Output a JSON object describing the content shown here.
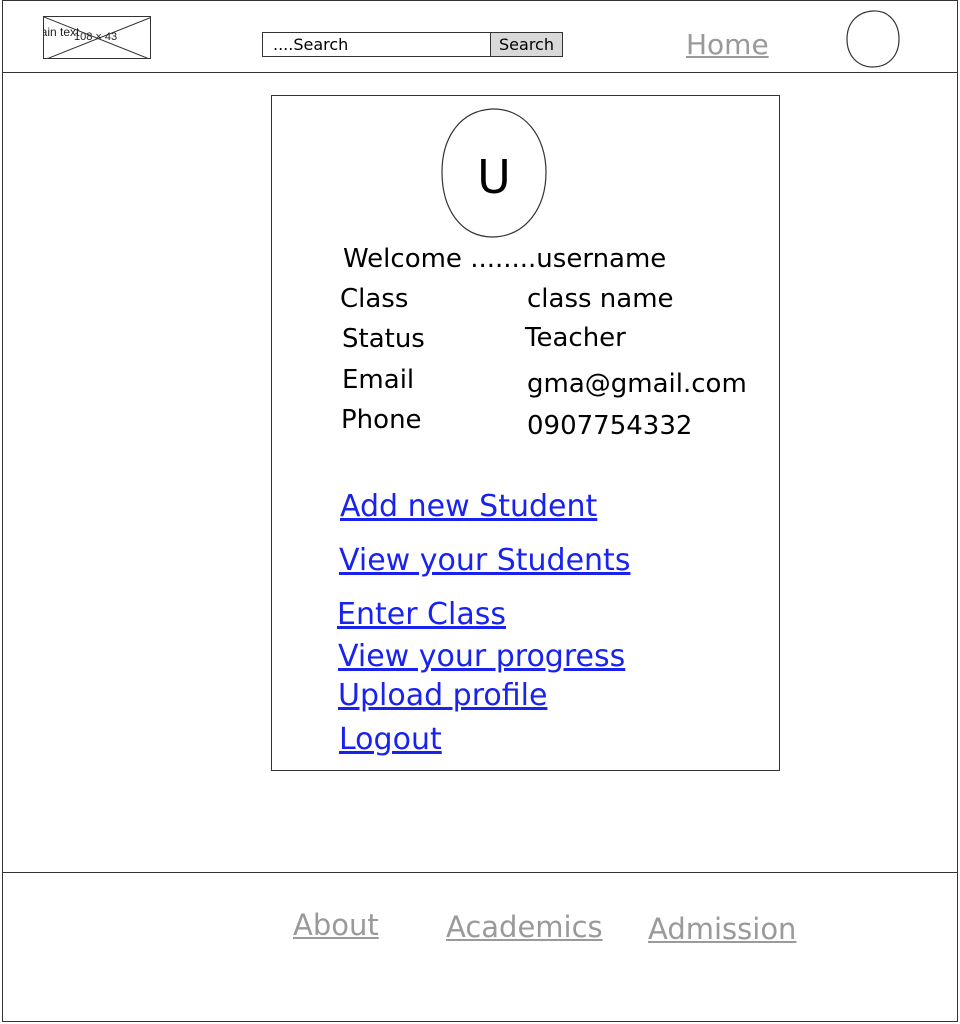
{
  "header": {
    "logo": {
      "caption": "Plain text",
      "size_label": "108 × 43"
    },
    "search": {
      "placeholder": "....Search",
      "button_label": "Search"
    },
    "nav": {
      "home": "Home"
    }
  },
  "profile": {
    "avatar_letter": "U",
    "welcome": "Welcome ........username",
    "fields": [
      {
        "label": "Class",
        "value": "class name"
      },
      {
        "label": "Status",
        "value": "Teacher"
      },
      {
        "label": "Email",
        "value": "gma@gmail.com"
      },
      {
        "label": "Phone",
        "value": "0907754332"
      }
    ],
    "links": [
      "Add new Student",
      "View your Students",
      "Enter Class",
      "View your progress",
      "Upload profile",
      "Logout"
    ]
  },
  "footer": {
    "links": [
      "About",
      "Academics",
      "Admission"
    ]
  },
  "colors": {
    "link": "#1a22ee",
    "muted_link": "#9a9a9a",
    "button_bg": "#d9d9d9"
  }
}
